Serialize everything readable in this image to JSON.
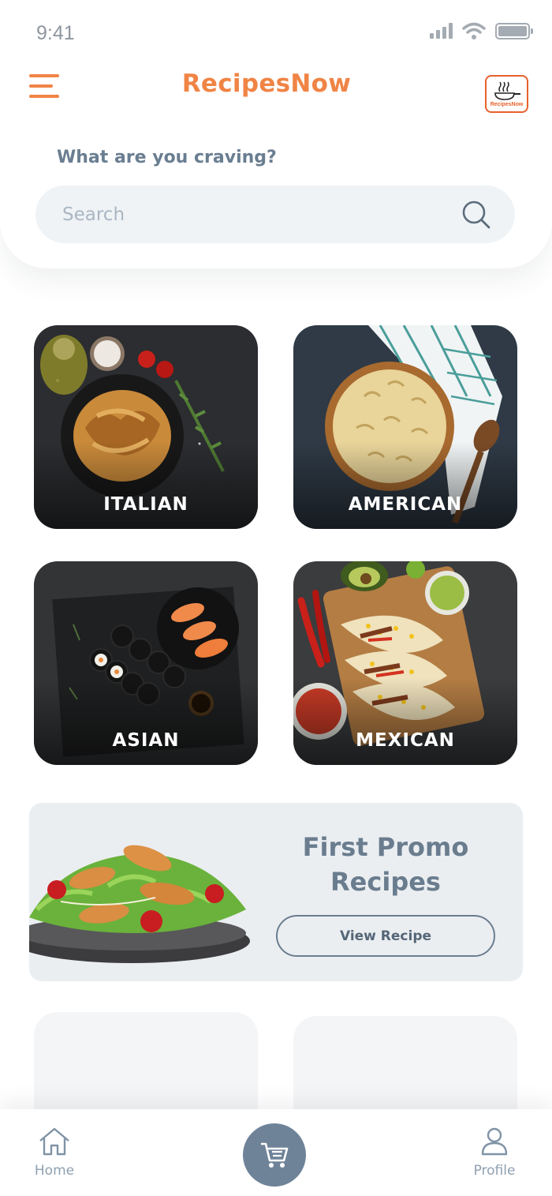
{
  "status_bar": {
    "time": "9:41"
  },
  "header": {
    "app_title": "RecipesNow",
    "logo_text": "RecipesNow",
    "prompt": "What are you craving?"
  },
  "search": {
    "placeholder": "Search",
    "value": ""
  },
  "categories": [
    {
      "label": "ITALIAN"
    },
    {
      "label": "AMERICAN"
    },
    {
      "label": "ASIAN"
    },
    {
      "label": "MEXICAN"
    }
  ],
  "promo": {
    "title_line1": "First Promo",
    "title_line2": "Recipes",
    "button_label": "View Recipe"
  },
  "bottom_nav": {
    "home_label": "Home",
    "profile_label": "Profile"
  },
  "colors": {
    "accent": "#f08445",
    "text_slate": "#6a7e91",
    "nav_slate": "#6f8398"
  }
}
